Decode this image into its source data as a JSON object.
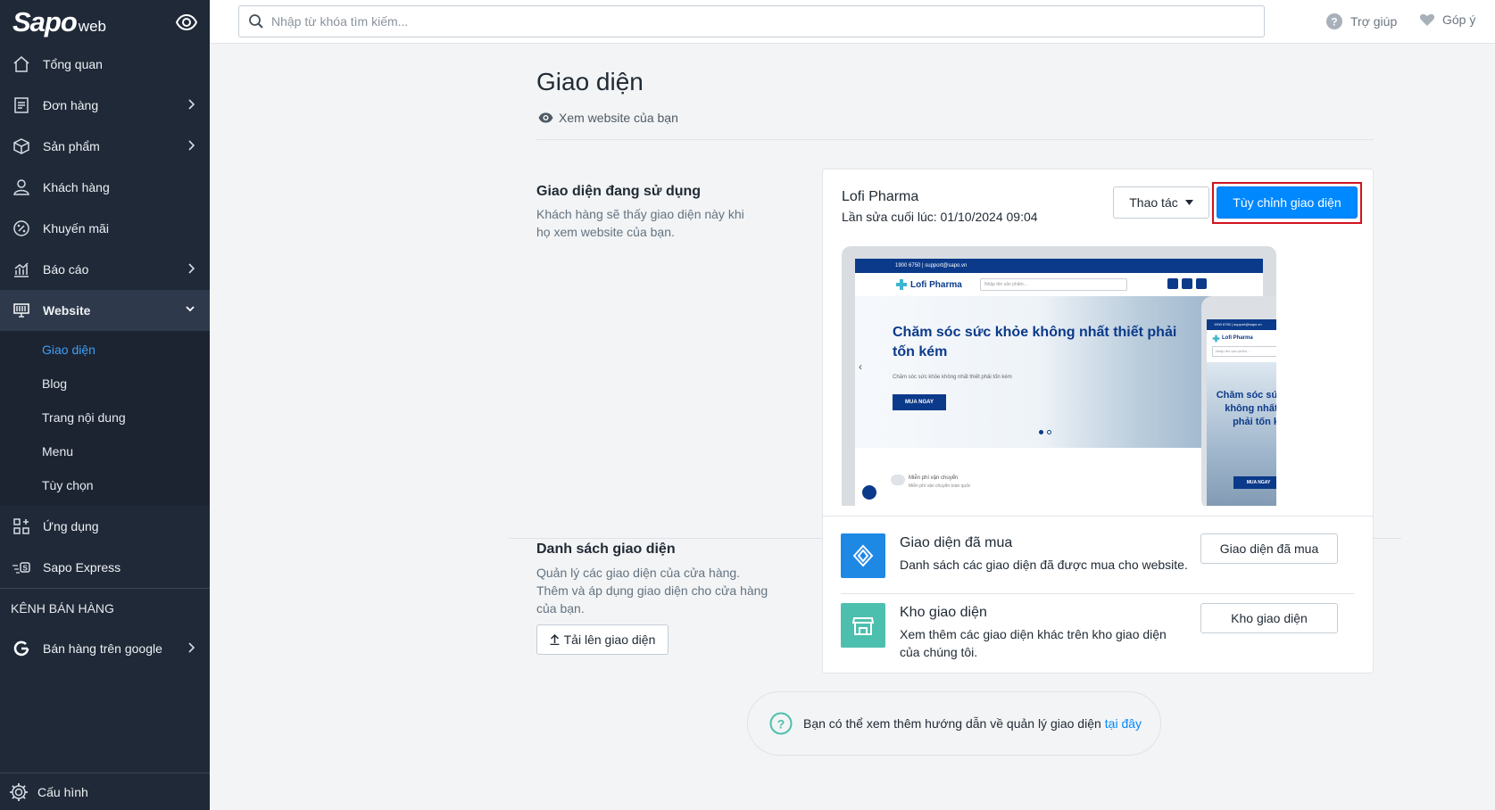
{
  "brand": {
    "logo_main": "Sapo",
    "logo_sub": "web"
  },
  "search": {
    "placeholder": "Nhập từ khóa tìm kiếm..."
  },
  "topbar": {
    "help_label": "Trợ giúp",
    "feedback_label": "Góp ý"
  },
  "sidebar": {
    "items": [
      {
        "label": "Tổng quan"
      },
      {
        "label": "Đơn hàng"
      },
      {
        "label": "Sản phẩm"
      },
      {
        "label": "Khách hàng"
      },
      {
        "label": "Khuyến mãi"
      },
      {
        "label": "Báo cáo"
      },
      {
        "label": "Website"
      }
    ],
    "website_sub": [
      {
        "label": "Giao diện"
      },
      {
        "label": "Blog"
      },
      {
        "label": "Trang nội dung"
      },
      {
        "label": "Menu"
      },
      {
        "label": "Tùy chọn"
      }
    ],
    "apps_label": "Ứng dụng",
    "express_label": "Sapo Express",
    "channels_heading": "KÊNH BÁN HÀNG",
    "google_label": "Bán hàng trên google",
    "config_label": "Cấu hình"
  },
  "page": {
    "title": "Giao diện",
    "view_site": "Xem website của bạn"
  },
  "current_theme": {
    "section_title": "Giao diện đang sử dụng",
    "section_desc": "Khách hàng sẽ thấy giao diện này khi họ xem website của bạn.",
    "name": "Lofi Pharma",
    "last_edited": "Lần sửa cuối lúc: 01/10/2024 09:04",
    "actions_label": "Thao tác",
    "customize_label": "Tùy chỉnh giao diện",
    "preview": {
      "topstrip": "1900 6750  |  support@sapo.vn",
      "logo": "Lofi Pharma",
      "search_placeholder": "Nhập tên sản phẩm...",
      "hero_title": "Chăm sóc sức khỏe không nhất thiết phải tốn kém",
      "hero_sub": "Chăm sóc sức khỏe không nhất thiết phải tốn kém",
      "hero_button": "MUA NGAY",
      "shipping_title": "Miễn phí vận chuyển",
      "shipping_sub": "Miễn phí vận chuyển toàn quốc",
      "phone_title": "Chăm sóc sức khỏe không nhất thiết phải tốn kém",
      "phone_button": "MUA NGAY"
    }
  },
  "theme_list": {
    "section_title": "Danh sách giao diện",
    "section_desc": "Quản lý các giao diện của cửa hàng. Thêm và áp dụng giao diện cho cửa hàng của bạn.",
    "upload_label": "Tải lên giao diện",
    "purchased": {
      "title": "Giao diện đã mua",
      "desc": "Danh sách các giao diện đã được mua cho website.",
      "button": "Giao diện đã mua"
    },
    "store": {
      "title": "Kho giao diện",
      "desc": "Xem thêm các giao diện khác trên kho giao diện của chúng tôi.",
      "button": "Kho giao diện"
    }
  },
  "help": {
    "text": "Bạn có thể xem thêm hướng dẫn về quản lý giao diện",
    "link": "tại đây"
  },
  "colors": {
    "sidebar_bg": "#1f2938",
    "primary": "#0088ff",
    "active_link": "#3e9ff5",
    "highlight_box": "#d0121f",
    "purchased_icon_bg": "#1e88e5",
    "store_icon_bg": "#4dbfae"
  },
  "icons": {
    "sidebar": [
      "home-icon",
      "order-icon",
      "product-icon",
      "customer-icon",
      "discount-icon",
      "report-icon",
      "website-icon",
      "apps-icon",
      "express-icon",
      "google-icon",
      "gear-icon"
    ],
    "topbar": [
      "search-icon",
      "help-icon",
      "heart-icon",
      "eye-icon"
    ]
  }
}
